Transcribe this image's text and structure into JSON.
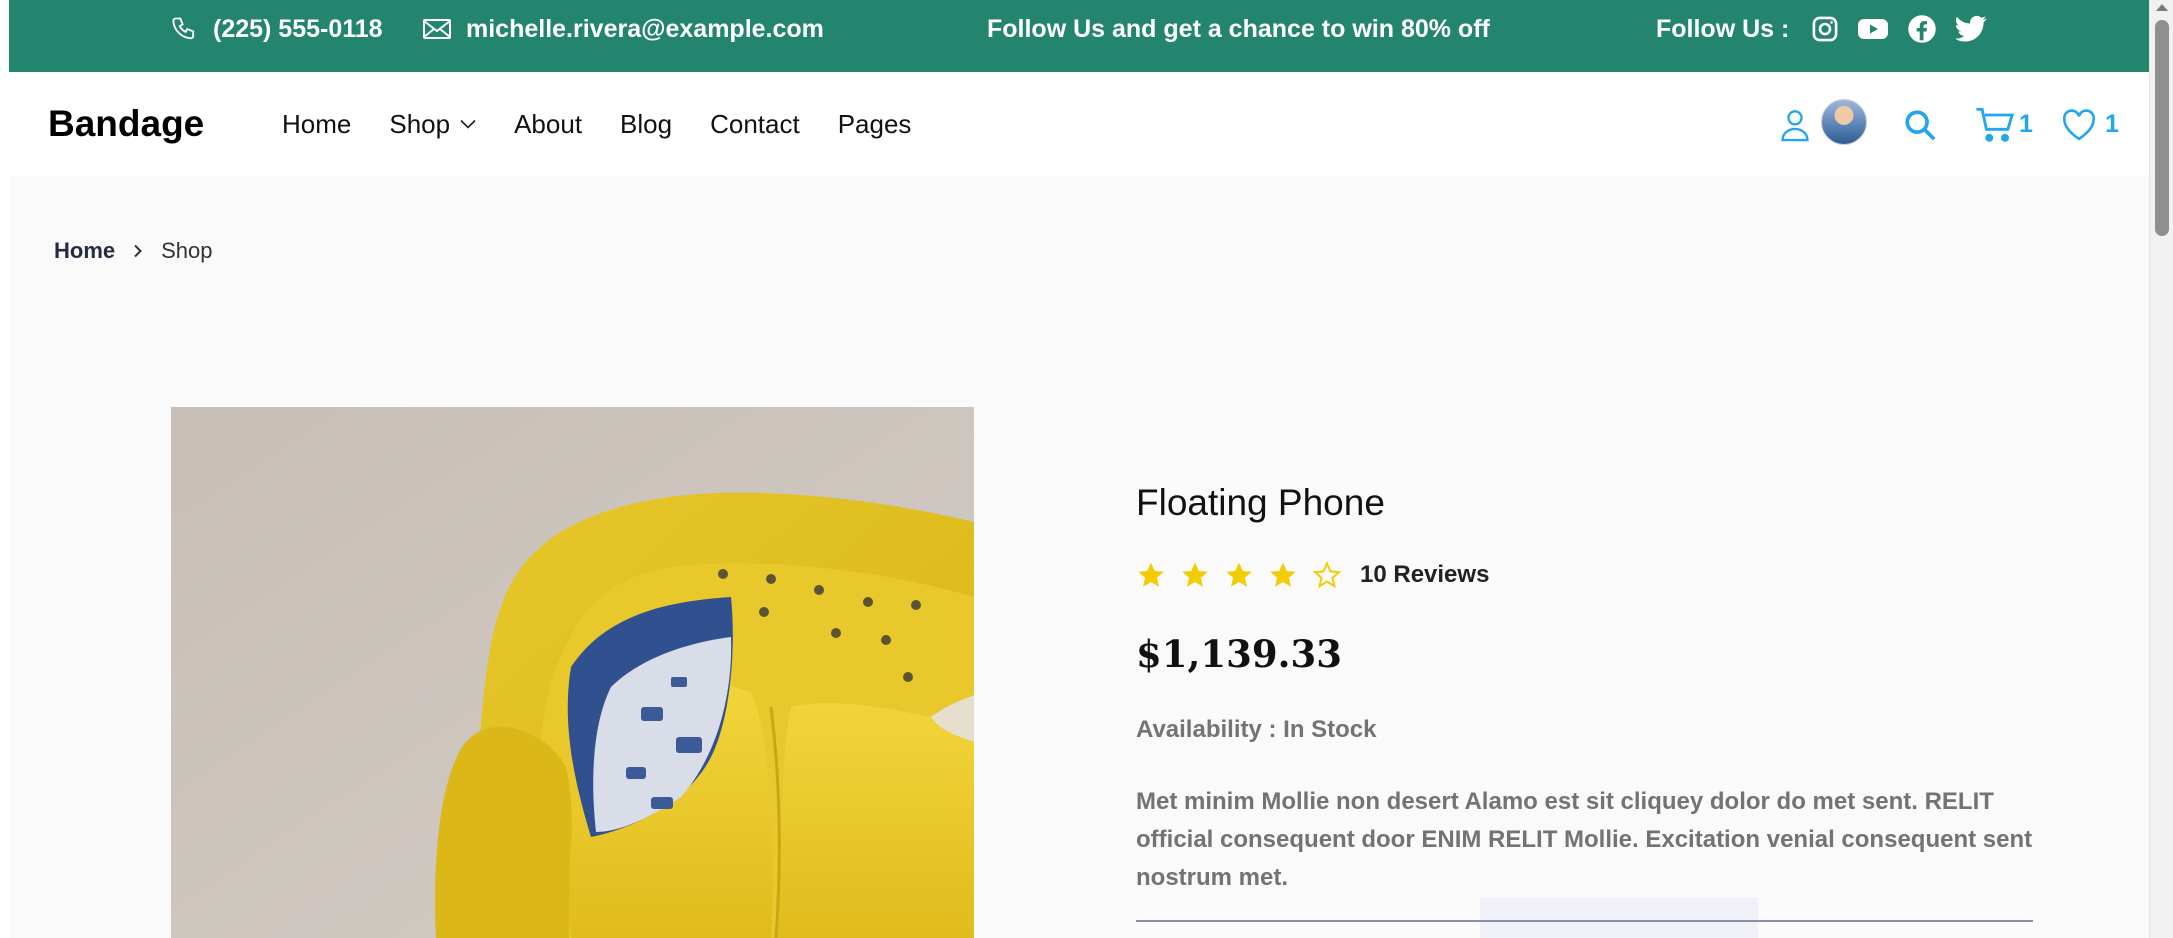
{
  "topbar": {
    "phone": "(225) 555-0118",
    "email": "michelle.rivera@example.com",
    "promo": "Follow Us and get a chance to win 80% off",
    "follow_label": "Follow Us :",
    "social_icons": [
      "instagram-icon",
      "youtube-icon",
      "facebook-icon",
      "twitter-icon"
    ],
    "bg_color": "#23856d"
  },
  "navbar": {
    "brand": "Bandage",
    "links": [
      "Home",
      "Shop",
      "About",
      "Blog",
      "Contact",
      "Pages"
    ],
    "cart_count": "1",
    "wishlist_count": "1",
    "accent_color": "#23a6f0"
  },
  "breadcrumb": {
    "home": "Home",
    "current": "Shop"
  },
  "product": {
    "title": "Floating Phone",
    "rating": 4,
    "rating_max": 5,
    "reviews": "10 Reviews",
    "price": "$1,139.33",
    "availability": "Availability : In Stock",
    "description": "Met minim Mollie non desert Alamo est sit cliquey dolor do met sent. RELIT official consequent door ENIM RELIT Mollie. Excitation venial consequent sent nostrum met.",
    "star_color": "#f3cd03"
  }
}
